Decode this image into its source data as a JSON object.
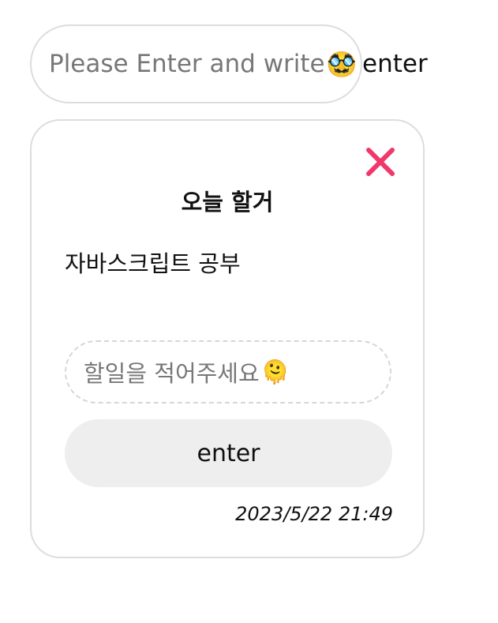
{
  "header": {
    "input_placeholder": "Please Enter and write",
    "input_emoji": "🥸",
    "enter_label": "enter"
  },
  "card": {
    "title": "오늘 할거",
    "items": [
      "자바스크립트 공부"
    ],
    "input_placeholder": "할일을 적어주세요",
    "input_emoji": "🫠",
    "enter_label": "enter",
    "timestamp": "2023/5/22 21:49"
  },
  "colors": {
    "close_icon": "#f0386b",
    "border": "#dddddd",
    "button_bg": "#eeeeee"
  }
}
